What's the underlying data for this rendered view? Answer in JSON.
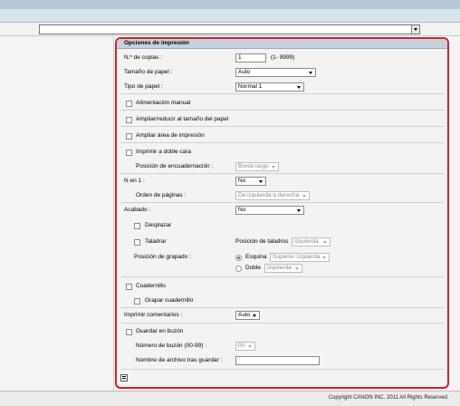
{
  "top_select": {
    "value": ""
  },
  "panel": {
    "title": "Opciones de impresión",
    "copies": {
      "label": "N.º de copias :",
      "value": "1",
      "range": "(1- 9999)"
    },
    "paper_size": {
      "label": "Tamaño de papel :",
      "value": "Auto"
    },
    "paper_type": {
      "label": "Tipo de papel :",
      "value": "Normal 1"
    },
    "manual_feed": {
      "label": "Alimentación manual"
    },
    "fit_to_paper": {
      "label": "Ampliar/reducir al tamaño del papel"
    },
    "enlarge_area": {
      "label": "Ampliar área de impresión"
    },
    "duplex": {
      "label": "Imprimir a doble cara"
    },
    "binding": {
      "label": "Posición de encuadernación :",
      "value": "Borde largo"
    },
    "n_up": {
      "label": "N en 1 :",
      "value": "No"
    },
    "page_order": {
      "label": "Orden de páginas :",
      "value": "De izquierda a derecha"
    },
    "finishing": {
      "label": "Acabado :",
      "value": "No"
    },
    "offset": {
      "label": "Desplazar"
    },
    "punch": {
      "label": "Taladrar"
    },
    "punch_position": {
      "label": "Posición de taladros",
      "value": "Izquierda"
    },
    "staple_position": {
      "label": "Posición de grapado :"
    },
    "staple_corner": {
      "label": "Esquina",
      "value": "Superior izquierda"
    },
    "staple_double": {
      "label": "Doble",
      "value": "Izquierda"
    },
    "booklet": {
      "label": "Cuadernillo"
    },
    "booklet_staple": {
      "label": "Grapar cuadernillo"
    },
    "comments": {
      "label": "Imprimir comentarios :",
      "value": "Auto"
    },
    "mailbox": {
      "label": "Guardar en buzón"
    },
    "mailbox_number": {
      "label": "Número de buzón (00-99) :",
      "value": "00"
    },
    "file_name": {
      "label": "Nombre de archivo tras guardar :",
      "value": ""
    }
  },
  "footer": {
    "copyright": "Copyright CANON INC. 2011 All Rights Reserved"
  },
  "colors": {
    "accent_border": "#d81e2a",
    "header_bg": "#c7d1db"
  }
}
